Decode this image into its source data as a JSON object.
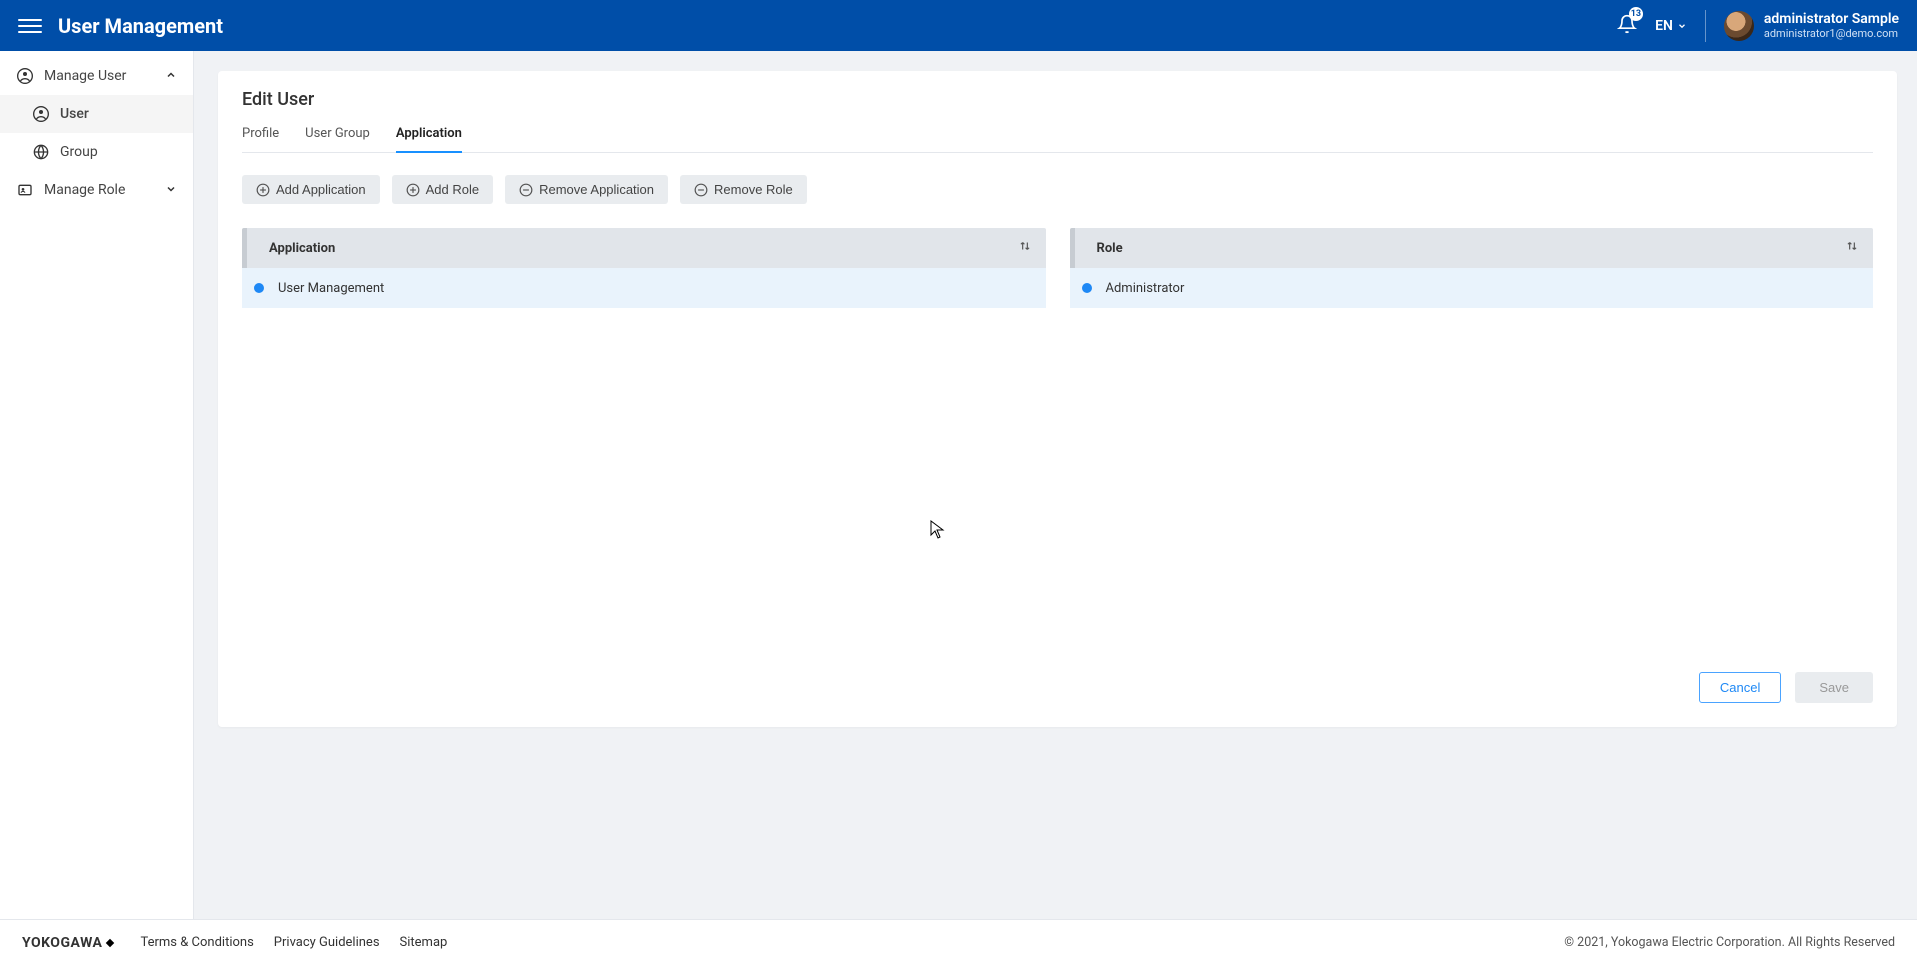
{
  "header": {
    "title": "User Management",
    "notifications": "13",
    "language": "EN",
    "user_name": "administrator Sample",
    "user_email": "administrator1@demo.com"
  },
  "sidebar": {
    "groups": [
      {
        "label": "Manage User",
        "icon": "user-circle",
        "expanded": true,
        "items": [
          {
            "label": "User",
            "icon": "user-circle",
            "active": true
          },
          {
            "label": "Group",
            "icon": "globe",
            "active": false
          }
        ]
      },
      {
        "label": "Manage Role",
        "icon": "id-card",
        "expanded": false,
        "items": []
      }
    ]
  },
  "main": {
    "title": "Edit User",
    "tabs": [
      {
        "label": "Profile",
        "active": false
      },
      {
        "label": "User Group",
        "active": false
      },
      {
        "label": "Application",
        "active": true
      }
    ],
    "toolbar": {
      "add_app": "Add Application",
      "add_role": "Add Role",
      "remove_app": "Remove Application",
      "remove_role": "Remove Role"
    },
    "app_panel": {
      "header": "Application",
      "rows": [
        {
          "label": "User Management"
        }
      ]
    },
    "role_panel": {
      "header": "Role",
      "rows": [
        {
          "label": "Administrator"
        }
      ]
    },
    "actions": {
      "cancel": "Cancel",
      "save": "Save"
    }
  },
  "footer": {
    "brand": "YOKOGAWA",
    "links": [
      "Terms & Conditions",
      "Privacy Guidelines",
      "Sitemap"
    ],
    "copyright": "© 2021, Yokogawa Electric Corporation. All Rights Reserved"
  }
}
